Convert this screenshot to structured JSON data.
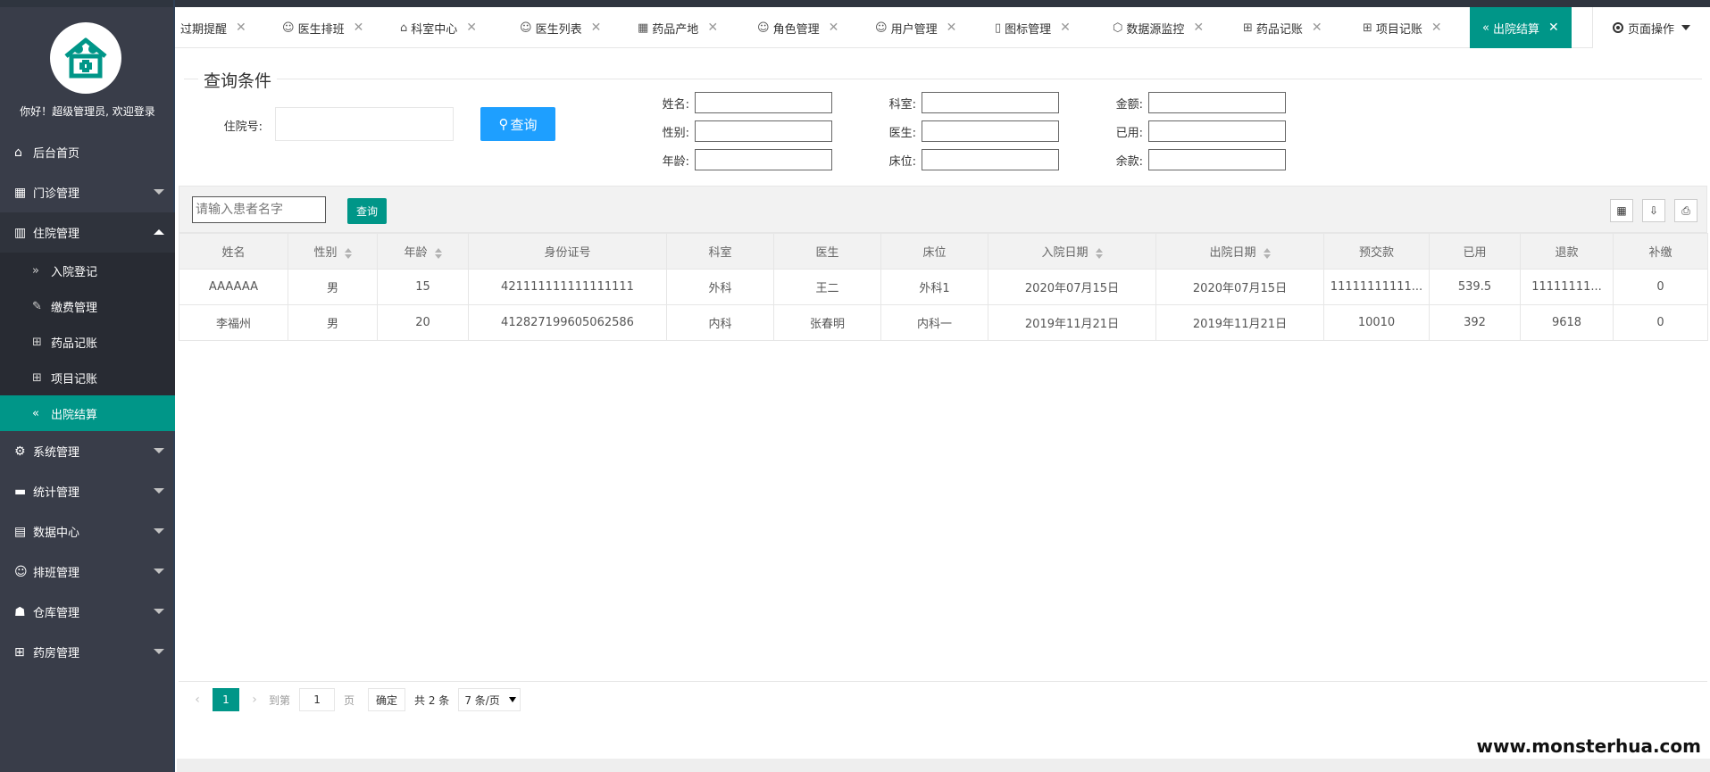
{
  "sidebar": {
    "greeting": "你好！超级管理员, 欢迎登录",
    "menu": [
      {
        "label": "后台首页",
        "icon": "home-icon"
      },
      {
        "label": "门诊管理",
        "icon": "apps-icon"
      },
      {
        "label": "住院管理",
        "icon": "building-icon"
      },
      {
        "label": "系统管理",
        "icon": "gear-icon"
      },
      {
        "label": "统计管理",
        "icon": "chat-icon"
      },
      {
        "label": "数据中心",
        "icon": "document-icon"
      },
      {
        "label": "排班管理",
        "icon": "user-icon"
      },
      {
        "label": "仓库管理",
        "icon": "group-icon"
      },
      {
        "label": "药房管理",
        "icon": "book-icon"
      }
    ],
    "submenu": [
      {
        "label": "入院登记",
        "icon": "double-chevron-right-icon"
      },
      {
        "label": "缴费管理",
        "icon": "edit-icon"
      },
      {
        "label": "药品记账",
        "icon": "book-icon"
      },
      {
        "label": "项目记账",
        "icon": "book-icon"
      },
      {
        "label": "出院结算",
        "icon": "double-chevron-left-icon"
      }
    ]
  },
  "tabs": [
    {
      "label": "过期提醒"
    },
    {
      "label": "医生排班"
    },
    {
      "label": "科室中心"
    },
    {
      "label": "医生列表"
    },
    {
      "label": "药品产地"
    },
    {
      "label": "角色管理"
    },
    {
      "label": "用户管理"
    },
    {
      "label": "图标管理"
    },
    {
      "label": "数据源监控"
    },
    {
      "label": "药品记账"
    },
    {
      "label": "项目记账"
    },
    {
      "label": "出院结算"
    }
  ],
  "page_ops": "页面操作",
  "query": {
    "legend": "查询条件",
    "hospital_no_label": "住院号:",
    "query_button": "查询",
    "labels": {
      "name": "姓名:",
      "dept": "科室:",
      "amount": "金额:",
      "gender": "性别:",
      "doctor": "医生:",
      "used": "已用:",
      "age": "年龄:",
      "bed": "床位:",
      "balance": "余款:"
    }
  },
  "toolbar": {
    "search_placeholder": "请输入患者名字",
    "search_button": "查询"
  },
  "table": {
    "headers": [
      "姓名",
      "性别",
      "年龄",
      "身份证号",
      "科室",
      "医生",
      "床位",
      "入院日期",
      "出院日期",
      "预交款",
      "已用",
      "退款",
      "补缴"
    ],
    "rows": [
      [
        "AAAAAA",
        "男",
        "15",
        "421111111111111111",
        "外科",
        "王二",
        "外科1",
        "2020年07月15日",
        "2020年07月15日",
        "11111111111...",
        "539.5",
        "11111111...",
        "0"
      ],
      [
        "李福州",
        "男",
        "20",
        "412827199605062586",
        "内科",
        "张春明",
        "内科一",
        "2019年11月21日",
        "2019年11月21日",
        "10010",
        "392",
        "9618",
        "0"
      ]
    ]
  },
  "pager": {
    "current": "1",
    "goto_label": "到第",
    "goto_value": "1",
    "page_unit": "页",
    "confirm": "确定",
    "total": "共 2 条",
    "page_size": "7 条/页"
  },
  "watermark": "www.monsterhua.com",
  "colors": {
    "accent": "#009688",
    "sidebar": "#393d49",
    "query_button": "#1e9fff"
  }
}
